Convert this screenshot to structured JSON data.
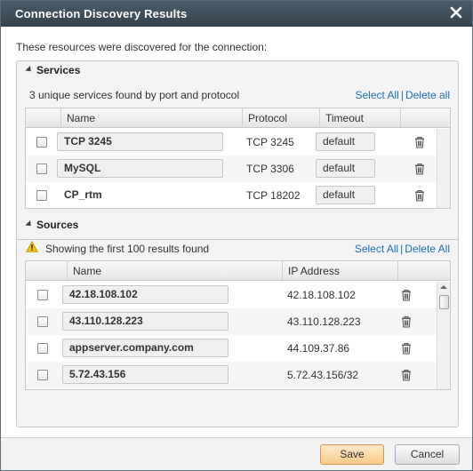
{
  "dialog": {
    "title": "Connection Discovery Results",
    "intro": "These resources were discovered for the connection:"
  },
  "services": {
    "heading": "Services",
    "summary": "3 unique services found by port and protocol",
    "select_all": "Select All",
    "separator": "|",
    "delete_all": "Delete all",
    "columns": {
      "name": "Name",
      "protocol": "Protocol",
      "timeout": "Timeout"
    },
    "rows": [
      {
        "name": "TCP 3245",
        "protocol": "TCP 3245",
        "timeout": "default"
      },
      {
        "name": "MySQL",
        "protocol": "TCP 3306",
        "timeout": "default"
      },
      {
        "name": "CP_rtm",
        "protocol": "TCP 18202",
        "timeout": "default"
      }
    ]
  },
  "sources": {
    "heading": "Sources",
    "summary": "Showing the first 100 results found",
    "select_all": "Select All",
    "separator": "|",
    "delete_all": "Delete All",
    "columns": {
      "name": "Name",
      "ip": "IP Address"
    },
    "rows": [
      {
        "name": "42.18.108.102",
        "ip": "42.18.108.102"
      },
      {
        "name": "43.110.128.223",
        "ip": "43.110.128.223"
      },
      {
        "name": "appserver.company.com",
        "ip": "44.109.37.86"
      },
      {
        "name": "5.72.43.156",
        "ip": "5.72.43.156/32"
      }
    ]
  },
  "footer": {
    "save_label": "Save",
    "cancel_label": "Cancel"
  },
  "colors": {
    "titlebar": "#3e4d59",
    "link": "#1e6fb8",
    "save_button": "#f7c98a",
    "warning": "#f2c200"
  }
}
